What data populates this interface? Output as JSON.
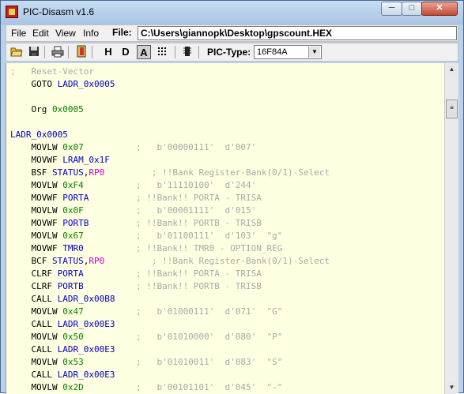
{
  "window": {
    "title": "PIC-Disasm v1.6",
    "min_glyph": "─",
    "max_glyph": "□",
    "close_glyph": "✕"
  },
  "menu": {
    "items": [
      "File",
      "Edit",
      "View",
      "Info"
    ],
    "file_label": "File:",
    "file_path": "C:\\Users\\giannopk\\Desktop\\gpscount.HEX"
  },
  "toolbar": {
    "h_label": "H",
    "d_label": "D",
    "a_label": "A",
    "pic_type_label": "PIC-Type:",
    "pic_type_value": "16F84A"
  },
  "code": [
    [
      [
        "c-comment",
        ";   Reset-Vector"
      ]
    ],
    [
      [
        "c-instr",
        "    GOTO "
      ],
      [
        "c-label",
        "LADR_0x0005"
      ]
    ],
    [],
    [
      [
        "c-instr",
        "    Org "
      ],
      [
        "c-num",
        "0x0005"
      ]
    ],
    [],
    [
      [
        "c-label",
        "LADR_0x0005"
      ]
    ],
    [
      [
        "c-instr",
        "    MOVLW "
      ],
      [
        "c-num",
        "0x07"
      ],
      [
        "c-comment",
        "          ;   b'00000111'  d'007'"
      ]
    ],
    [
      [
        "c-instr",
        "    MOVWF "
      ],
      [
        "c-label",
        "LRAM_0x1F"
      ]
    ],
    [
      [
        "c-instr",
        "    BSF "
      ],
      [
        "c-label",
        "STATUS"
      ],
      [
        "c-instr",
        ","
      ],
      [
        "c-pink",
        "RP0"
      ],
      [
        "c-comment",
        "         ; !!Bank Register-Bank(0/1)-Select"
      ]
    ],
    [
      [
        "c-instr",
        "    MOVLW "
      ],
      [
        "c-num",
        "0xF4"
      ],
      [
        "c-comment",
        "          ;   b'11110100'  d'244'"
      ]
    ],
    [
      [
        "c-instr",
        "    MOVWF "
      ],
      [
        "c-label",
        "PORTA"
      ],
      [
        "c-comment",
        "         ; !!Bank!! PORTA - TRISA"
      ]
    ],
    [
      [
        "c-instr",
        "    MOVLW "
      ],
      [
        "c-num",
        "0x0F"
      ],
      [
        "c-comment",
        "          ;   b'00001111'  d'015'"
      ]
    ],
    [
      [
        "c-instr",
        "    MOVWF "
      ],
      [
        "c-label",
        "PORTB"
      ],
      [
        "c-comment",
        "         ; !!Bank!! PORTB - TRISB"
      ]
    ],
    [
      [
        "c-instr",
        "    MOVLW "
      ],
      [
        "c-num",
        "0x67"
      ],
      [
        "c-comment",
        "          ;   b'01100111'  d'103'  \"g\""
      ]
    ],
    [
      [
        "c-instr",
        "    MOVWF "
      ],
      [
        "c-label",
        "TMR0"
      ],
      [
        "c-comment",
        "          ; !!Bank!! TMR0 - OPTION_REG"
      ]
    ],
    [
      [
        "c-instr",
        "    BCF "
      ],
      [
        "c-label",
        "STATUS"
      ],
      [
        "c-instr",
        ","
      ],
      [
        "c-pink",
        "RP0"
      ],
      [
        "c-comment",
        "         ; !!Bank Register-Bank(0/1)-Select"
      ]
    ],
    [
      [
        "c-instr",
        "    CLRF "
      ],
      [
        "c-label",
        "PORTA"
      ],
      [
        "c-comment",
        "          ; !!Bank!! PORTA - TRISA"
      ]
    ],
    [
      [
        "c-instr",
        "    CLRF "
      ],
      [
        "c-label",
        "PORTB"
      ],
      [
        "c-comment",
        "          ; !!Bank!! PORTB - TRISB"
      ]
    ],
    [
      [
        "c-instr",
        "    CALL "
      ],
      [
        "c-label",
        "LADR_0x00B8"
      ]
    ],
    [
      [
        "c-instr",
        "    MOVLW "
      ],
      [
        "c-num",
        "0x47"
      ],
      [
        "c-comment",
        "          ;   b'01000111'  d'071'  \"G\""
      ]
    ],
    [
      [
        "c-instr",
        "    CALL "
      ],
      [
        "c-label",
        "LADR_0x00E3"
      ]
    ],
    [
      [
        "c-instr",
        "    MOVLW "
      ],
      [
        "c-num",
        "0x50"
      ],
      [
        "c-comment",
        "          ;   b'01010000'  d'080'  \"P\""
      ]
    ],
    [
      [
        "c-instr",
        "    CALL "
      ],
      [
        "c-label",
        "LADR_0x00E3"
      ]
    ],
    [
      [
        "c-instr",
        "    MOVLW "
      ],
      [
        "c-num",
        "0x53"
      ],
      [
        "c-comment",
        "          ;   b'01010011'  d'083'  \"S\""
      ]
    ],
    [
      [
        "c-instr",
        "    CALL "
      ],
      [
        "c-label",
        "LADR_0x00E3"
      ]
    ],
    [
      [
        "c-instr",
        "    MOVLW "
      ],
      [
        "c-num",
        "0x2D"
      ],
      [
        "c-comment",
        "          ;   b'00101101'  d'045'  \"-\""
      ]
    ]
  ],
  "scrollbar": {
    "up_glyph": "▲",
    "down_glyph": "▼",
    "thumb_glyph": "≡"
  },
  "icons": {
    "open": "folder-open-icon",
    "save": "floppy-save-icon",
    "print": "printer-icon",
    "exit": "exit-door-icon",
    "mode_display": "dotted-grid-icon",
    "chip": "chip-icon"
  }
}
